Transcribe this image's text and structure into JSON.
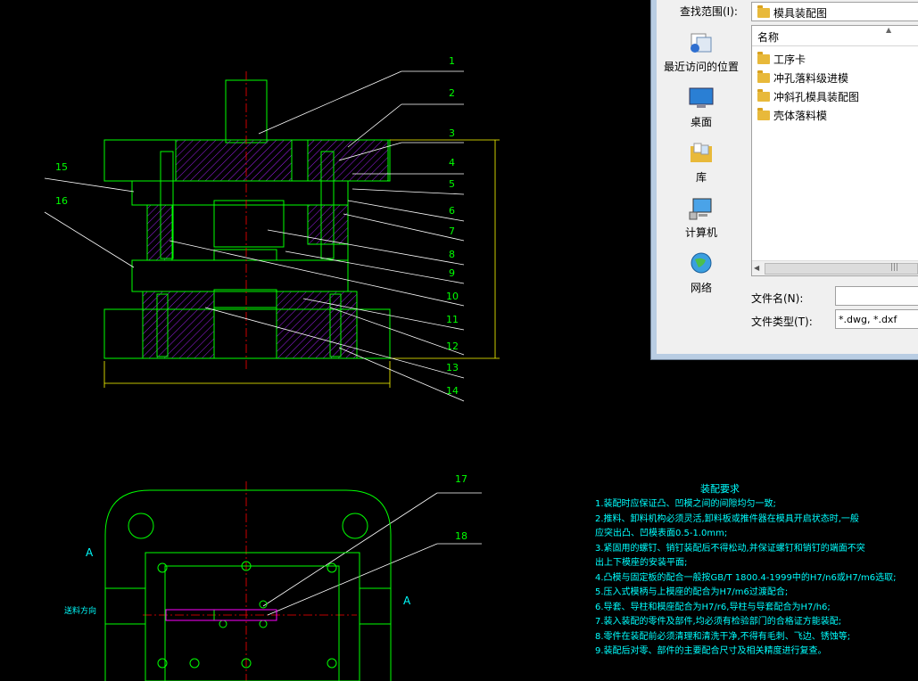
{
  "dialog": {
    "look_in_label": "查找范围(I):",
    "look_in_value": "模具装配图",
    "places": [
      {
        "label": "最近访问的位置",
        "icon": "recent-places-icon"
      },
      {
        "label": "桌面",
        "icon": "desktop-icon"
      },
      {
        "label": "库",
        "icon": "libraries-icon"
      },
      {
        "label": "计算机",
        "icon": "computer-icon"
      },
      {
        "label": "网络",
        "icon": "network-icon"
      }
    ],
    "column_name": "名称",
    "files": [
      "工序卡",
      "冲孔落料级进模",
      "冲斜孔模具装配图",
      "壳体落料模"
    ],
    "filename_label": "文件名(N):",
    "filename_value": "",
    "filetype_label": "文件类型(T):",
    "filetype_value": "*.dwg, *.dxf"
  },
  "drawing": {
    "part_numbers": [
      "1",
      "2",
      "3",
      "4",
      "5",
      "6",
      "7",
      "8",
      "9",
      "10",
      "11",
      "12",
      "13",
      "14",
      "15",
      "16",
      "17",
      "18"
    ],
    "section_label": "A",
    "feed_label": "送料方向",
    "requirements_title": "装配要求",
    "requirements": [
      "1.装配时应保证凸、凹模之间的间隙均匀一致;",
      "2.推料、卸料机构必须灵活,卸料板或推件器在模具开启状态时,一般",
      "  应突出凸、凹模表面0.5-1.0mm;",
      "3.紧固用的螺钉、销钉装配后不得松动,并保证螺钉和销钉的端面不突",
      "  出上下模座的安装平面;",
      "4.凸模与固定板的配合一般按GB/T 1800.4-1999中的H7/n6或H7/m6选取;",
      "5.压入式模柄与上模座的配合为H7/m6过渡配合;",
      "6.导套、导柱和模座配合为H7/r6,导柱与导套配合为H7/h6;",
      "7.装入装配的零件及部件,均必须有检验部门的合格证方能装配;",
      "8.零件在装配前必须清理和清洗干净,不得有毛刺、飞边、锈蚀等;",
      "9.装配后对零、部件的主要配合尺寸及相关精度进行复查。"
    ],
    "colors": {
      "outline": "#00ff00",
      "hatch": "#a020f0",
      "text": "#00ffff",
      "leader": "#ffffff",
      "center": "#ff0000",
      "dimension": "#ffff00"
    }
  }
}
